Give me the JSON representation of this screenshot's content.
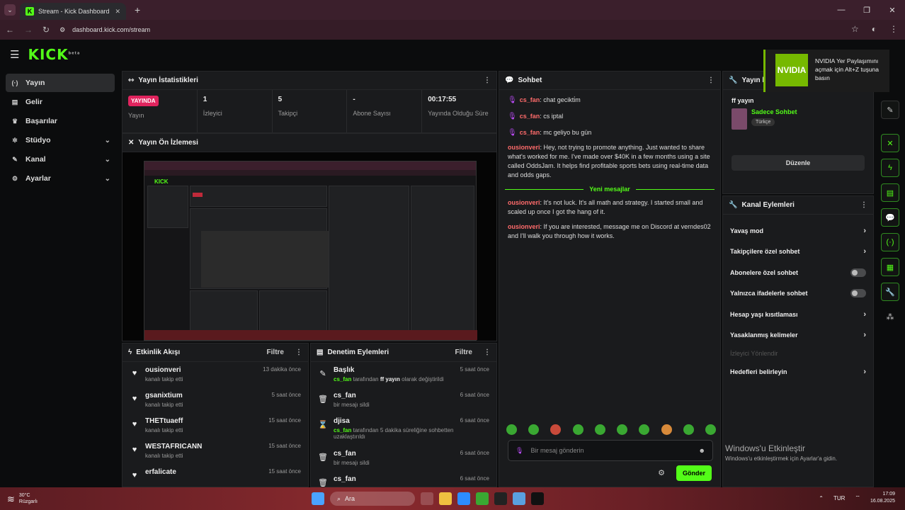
{
  "browser": {
    "tab_title": "Stream - Kick Dashboard",
    "url": "dashboard.kick.com/stream"
  },
  "brand": {
    "logo": "KICK",
    "logo_sup": "beta",
    "accent": "#53fc18"
  },
  "sidebar": {
    "items": [
      {
        "label": "Yayın",
        "icon": "broadcast-icon",
        "active": true
      },
      {
        "label": "Gelir",
        "icon": "wallet-icon"
      },
      {
        "label": "Başarılar",
        "icon": "trophy-icon"
      },
      {
        "label": "Stüdyo",
        "icon": "studio-icon",
        "expandable": true
      },
      {
        "label": "Kanal",
        "icon": "channel-icon",
        "expandable": true
      },
      {
        "label": "Ayarlar",
        "icon": "gear-icon",
        "expandable": true
      }
    ]
  },
  "stats": {
    "title": "Yayın İstatistikleri",
    "live_badge": "YAYINDA",
    "items": [
      {
        "value": "1",
        "label": "İzleyici"
      },
      {
        "value": "5",
        "label": "Takipçi"
      },
      {
        "value": "-",
        "label": "Abone Sayısı"
      },
      {
        "value": "00:17:55",
        "label": "Yayında Olduğu Süre"
      }
    ],
    "live_label": "Yayın"
  },
  "preview": {
    "title": "Yayın Ön İzlemesi",
    "mini_logo": "KICK"
  },
  "activity": {
    "title": "Etkinlik Akışı",
    "filter": "Filtre",
    "rows": [
      {
        "name": "ousionveri",
        "action": "kanalı takip etti",
        "time": "13 dakika önce"
      },
      {
        "name": "gsanixtium",
        "action": "kanalı takip etti",
        "time": "5 saat önce"
      },
      {
        "name": "THETtuaeff",
        "action": "kanalı takip etti",
        "time": "15 saat önce"
      },
      {
        "name": "WESTAFRICANN",
        "action": "kanalı takip etti",
        "time": "15 saat önce"
      },
      {
        "name": "erfalicate",
        "action": "",
        "time": "15 saat önce"
      }
    ]
  },
  "moderation": {
    "title": "Denetim Eylemleri",
    "filter": "Filtre",
    "rows": [
      {
        "name": "Başlık",
        "user": "cs_fan",
        "action": "tarafından",
        "target": "ff yayın",
        "action2": "olarak değiştirildi",
        "time": "5 saat önce",
        "icon": "title-icon"
      },
      {
        "name": "cs_fan",
        "action": "bir mesajı sildi",
        "time": "6 saat önce",
        "icon": "trash-icon"
      },
      {
        "name": "djisa",
        "user": "cs_fan",
        "action": "tarafından 5 dakika süreliğine sohbetten uzaklaştırıldı",
        "time": "6 saat önce",
        "icon": "hourglass-icon"
      },
      {
        "name": "cs_fan",
        "action": "bir mesajı sildi",
        "time": "6 saat önce",
        "icon": "trash-icon"
      },
      {
        "name": "cs_fan",
        "action": "",
        "time": "6 saat önce",
        "icon": "trash-icon"
      }
    ]
  },
  "chat": {
    "title": "Sohbet",
    "messages": [
      {
        "user": "cs_fan",
        "text": "chat gecikti̇m",
        "mod": true
      },
      {
        "user": "cs_fan",
        "text": "cs iptal",
        "mod": true
      },
      {
        "user": "cs_fan",
        "text": "mc geliyo bu gün",
        "mod": true
      },
      {
        "user": "ousionveri",
        "text": "Hey, not trying to promote anything. Just wanted to share what's worked for me. I've made over $40K in a few months using a site called OddsJam. It helps find profitable sports bets using real-time data and odds gaps."
      }
    ],
    "new_messages_label": "Yeni mesajlar",
    "new_messages": [
      {
        "user": "ousionveri",
        "text": "It's not luck. It's all math and strategy. I started small and scaled up once I got the hang of it."
      },
      {
        "user": "ousionveri",
        "text": "If you are interested, message me on Discord at verndes02 and I'll walk you through how it works."
      }
    ],
    "input_placeholder": "Bir mesaj gönderin",
    "send_label": "Gönder"
  },
  "stream_info": {
    "title": "Yayın bilgisi",
    "stream_title": "ff yayın",
    "category": "Sadece Sohbet",
    "tag": "Türkçe",
    "edit_label": "Düzenle"
  },
  "channel_actions": {
    "title": "Kanal Eylemleri",
    "rows": [
      {
        "label": "Yavaş mod",
        "kind": "chev"
      },
      {
        "label": "Takipçilere özel sohbet",
        "kind": "chev"
      },
      {
        "label": "Abonelere özel sohbet",
        "kind": "toggle"
      },
      {
        "label": "Yalnızca ifadelerle sohbet",
        "kind": "toggle"
      },
      {
        "label": "Hesap yaşı kısıtlaması",
        "kind": "chev"
      },
      {
        "label": "Yasaklanmış kelimeler",
        "kind": "chev"
      },
      {
        "label": "İzleyici Yönlendir",
        "kind": "dim"
      },
      {
        "label": "Hedefleri belirleyin",
        "kind": "chev"
      }
    ]
  },
  "toast": {
    "text": "NVIDIA Yer Paylaşımını açmak için Alt+Z tuşuna basın",
    "logo": "NVIDIA"
  },
  "watermark": {
    "line1": "Windows'u Etkinleştir",
    "line2": "Windows'u etkinleştirmek için Ayarlar'a gidin."
  },
  "taskbar": {
    "temp": "30°C",
    "weather": "Rüzgarlı",
    "search": "Ara",
    "lang": "TUR",
    "time": "17:09",
    "date": "16.08.2025"
  }
}
